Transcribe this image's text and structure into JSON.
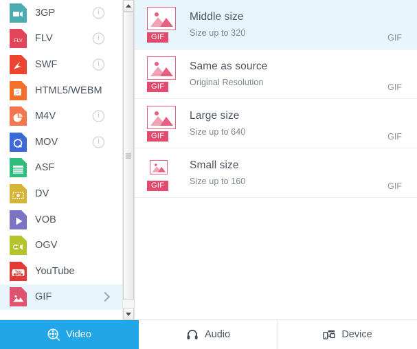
{
  "colors": {
    "accent": "#21a7e8",
    "selection": "#e9f5fd",
    "gif_pink": "#e24a6e",
    "thumb_border": "#e8607f"
  },
  "sidebar": {
    "items": [
      {
        "label": "3GP",
        "icon": "camcorder-icon",
        "color": "#4cabb0",
        "has_info": true,
        "has_chevron": false,
        "selected": false
      },
      {
        "label": "FLV",
        "icon": "flv-icon",
        "color": "#e1465a",
        "has_info": true,
        "has_chevron": false,
        "selected": false
      },
      {
        "label": "SWF",
        "icon": "swoosh-icon",
        "color": "#ec4431",
        "has_info": true,
        "has_chevron": false,
        "selected": false
      },
      {
        "label": "HTML5/WEBM",
        "icon": "html5-icon",
        "color": "#f4702a",
        "has_info": false,
        "has_chevron": false,
        "selected": false
      },
      {
        "label": "M4V",
        "icon": "pie-icon",
        "color": "#f4764f",
        "has_info": true,
        "has_chevron": false,
        "selected": false
      },
      {
        "label": "MOV",
        "icon": "quicktime-icon",
        "color": "#3d68d8",
        "has_info": true,
        "has_chevron": false,
        "selected": false
      },
      {
        "label": "ASF",
        "icon": "filmstrip-icon",
        "color": "#2fbd7e",
        "has_info": false,
        "has_chevron": false,
        "selected": false
      },
      {
        "label": "DV",
        "icon": "tape-icon",
        "color": "#d6b435",
        "has_info": false,
        "has_chevron": false,
        "selected": false
      },
      {
        "label": "VOB",
        "icon": "play-icon",
        "color": "#7b74c4",
        "has_info": false,
        "has_chevron": false,
        "selected": false
      },
      {
        "label": "OGV",
        "icon": "movie-camera-icon",
        "color": "#b5c42b",
        "has_info": false,
        "has_chevron": false,
        "selected": false
      },
      {
        "label": "YouTube",
        "icon": "youtube-icon",
        "color": "#e23a36",
        "has_info": false,
        "has_chevron": false,
        "selected": false
      },
      {
        "label": "GIF",
        "icon": "image-icon",
        "color": "#e0536f",
        "has_info": false,
        "has_chevron": true,
        "selected": true
      }
    ]
  },
  "scrollbar": {
    "up_arrow": "scroll-up-arrow-icon",
    "down_arrow": "scroll-down-arrow-icon",
    "thumb": "scrollbar-thumb"
  },
  "presets": {
    "items": [
      {
        "title": "Middle size",
        "subtitle": "Size up to 320",
        "ext": "GIF",
        "badge": "GIF",
        "thumb_size": "big",
        "selected": true
      },
      {
        "title": "Same as source",
        "subtitle": "Original Resolution",
        "ext": "GIF",
        "badge": "GIF",
        "thumb_size": "big",
        "selected": false
      },
      {
        "title": "Large size",
        "subtitle": "Size up to 640",
        "ext": "GIF",
        "badge": "GIF",
        "thumb_size": "big",
        "selected": false
      },
      {
        "title": "Small size",
        "subtitle": "Size up to 160",
        "ext": "GIF",
        "badge": "GIF",
        "thumb_size": "small",
        "selected": false
      }
    ]
  },
  "tabs": {
    "items": [
      {
        "label": "Video",
        "icon": "film-reel-icon",
        "active": true
      },
      {
        "label": "Audio",
        "icon": "headphones-icon",
        "active": false
      },
      {
        "label": "Device",
        "icon": "devices-icon",
        "active": false
      }
    ]
  }
}
